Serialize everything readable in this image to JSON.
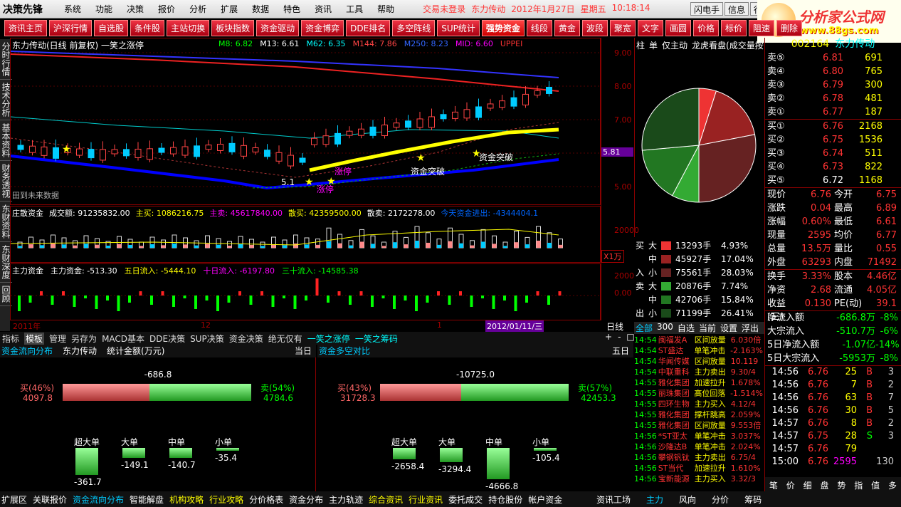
{
  "app": {
    "logo": "决策先锋",
    "menus": [
      "系统",
      "功能",
      "决策",
      "报价",
      "分析",
      "扩展",
      "数据",
      "特色",
      "资讯",
      "工具",
      "帮助"
    ],
    "login": "交易未登录",
    "stock_head": "东力传动",
    "date": "2012年1月27日",
    "weekday": "星期五",
    "time": "10:18:14",
    "right_buttons": [
      "闪电手",
      "信息",
      "行"
    ]
  },
  "brand": {
    "name": "分析家公式网",
    "url": "www.88gs.com"
  },
  "toolbar": [
    "资讯主页",
    "沪深行情",
    "自选股",
    "条件股",
    "主站切换",
    "板块指数",
    "资金驱动",
    "资金博弈",
    "DDE排名",
    "多空阵线",
    "SUP统计",
    "强势资金",
    "线段",
    "黄金",
    "波段",
    "聚宽",
    "文字",
    "画圆",
    "价格",
    "标价",
    "阻速",
    "删除"
  ],
  "side": [
    "分时行情",
    "技术分析",
    "基本资料",
    "财务透视",
    "东财资料",
    "东财深度",
    "回顾"
  ],
  "main": {
    "title": "东力传动(日线 前复权) 一笑之涨停",
    "ma": [
      {
        "t": "M8: 6.82",
        "c": "#0f0"
      },
      {
        "t": "M13: 6.61",
        "c": "#fff"
      },
      {
        "t": "M62: 6.35",
        "c": "#0ff"
      },
      {
        "t": "M144: 7.86",
        "c": "#f44"
      },
      {
        "t": "M250: 8.23",
        "c": "#36f"
      },
      {
        "t": "MID: 6.60",
        "c": "#f0f"
      },
      {
        "t": "UPPEI",
        "c": "#f33"
      }
    ],
    "yaxis": [
      "9.00",
      "8.00",
      "7.00",
      "5.81",
      "5.00"
    ],
    "ann": [
      "资金突破",
      "资金突破",
      "涨停",
      "涨停",
      "5.1"
    ],
    "nofuture": "田到未来数据"
  },
  "sub1": {
    "label": "庄散资金",
    "items": [
      "成交额: 91235832.00",
      "主买: 1086216.75",
      "主卖: 45617840.00",
      "散买: 42359500.00",
      "散卖: 2172278.00",
      "今天资金进出: -4344404.1"
    ],
    "yaxis": [
      "20000",
      "X1万"
    ]
  },
  "sub2": {
    "label": "主力资金",
    "items": [
      "主力资金: -513.30",
      "五日流入: -5444.10",
      "十日流入: -6197.80",
      "三十流入: -14585.38"
    ],
    "yaxis": [
      "2000",
      "0.00"
    ]
  },
  "timeaxis": {
    "t1": "2011年",
    "t2": "12",
    "t3": "1",
    "t4": "2012/01/11/三",
    "t5": "日线"
  },
  "tabs1": [
    "指标",
    "模板",
    "管理",
    "另存为",
    "MACD基本",
    "DDE决策",
    "SUP决策",
    "资金决策",
    "绝无仅有",
    "一笑之涨停",
    "一笑之筹码"
  ],
  "panelL": {
    "title": "资金流向分布",
    "stock": "东力传动",
    "unit": "统计金额(万元)",
    "period": "当日",
    "diff": "-686.8",
    "buy_pct": "买(46%)",
    "buy_val": "4097.8",
    "sell_pct": "卖(54%)",
    "sell_val": "4784.6",
    "cats": [
      {
        "n": "超大单",
        "v": "-361.7"
      },
      {
        "n": "大单",
        "v": "-149.1"
      },
      {
        "n": "中单",
        "v": "-140.7"
      },
      {
        "n": "小单",
        "v": "-35.4"
      }
    ]
  },
  "panelR": {
    "title": "资金多空对比",
    "period": "五日",
    "diff": "-10725.0",
    "buy_pct": "买(43%)",
    "buy_val": "31728.3",
    "sell_pct": "卖(57%)",
    "sell_val": "42453.3",
    "cats": [
      {
        "n": "超大单",
        "v": "-2658.4"
      },
      {
        "n": "大单",
        "v": "-3294.4"
      },
      {
        "n": "中单",
        "v": "-4666.8"
      },
      {
        "n": "小单",
        "v": "-105.4"
      }
    ]
  },
  "pie": {
    "tabs": [
      "柱",
      "单",
      "仅主动",
      "龙虎看盘(成交量按"
    ],
    "slices": [
      {
        "v": 4.93,
        "c": "#e33"
      },
      {
        "v": 17.04,
        "c": "#922"
      },
      {
        "v": 28.03,
        "c": "#622"
      },
      {
        "v": 7.74,
        "c": "#3a3"
      },
      {
        "v": 15.84,
        "c": "#272"
      },
      {
        "v": 26.41,
        "c": "#1a4a1a"
      }
    ]
  },
  "bigs": [
    {
      "g": "买",
      "k": "大",
      "v": "13293手",
      "p": "4.93%",
      "c": "#e33"
    },
    {
      "g": "",
      "k": "中",
      "v": "45927手",
      "p": "17.04%",
      "c": "#922"
    },
    {
      "g": "入",
      "k": "小",
      "v": "75561手",
      "p": "28.03%",
      "c": "#622"
    },
    {
      "g": "卖",
      "k": "大",
      "v": "20876手",
      "p": "7.74%",
      "c": "#3a3"
    },
    {
      "g": "",
      "k": "中",
      "v": "42706手",
      "p": "15.84%",
      "c": "#272"
    },
    {
      "g": "出",
      "k": "小",
      "v": "71199手",
      "p": "26.41%",
      "c": "#1a4a1a"
    }
  ],
  "dealtabs": [
    "全部",
    "300",
    "自选",
    "当前",
    "设置",
    "浮出"
  ],
  "deals": [
    [
      "14:54",
      "闽福发A",
      "区间放量",
      "6.030倍"
    ],
    [
      "14:54",
      "ST盛达",
      "单笔冲击",
      "-2.163%"
    ],
    [
      "14:54",
      "华闻传媒",
      "区间放量",
      "10.119"
    ],
    [
      "14:54",
      "中联重科",
      "主力卖出",
      "9.30/4"
    ],
    [
      "14:55",
      "雅化集团",
      "加速拉升",
      "1.678%"
    ],
    [
      "14:55",
      "丽珠集团",
      "高位回落",
      "-1.514%"
    ],
    [
      "14:55",
      "四环生物",
      "主力买入",
      "4.12/4"
    ],
    [
      "14:55",
      "雅化集团",
      "撑杆跳高",
      "2.059%"
    ],
    [
      "14:55",
      "雅化集团",
      "区间放量",
      "9.553倍"
    ],
    [
      "14:56",
      "*ST亚太",
      "单笔冲击",
      "3.037%"
    ],
    [
      "14:56",
      "沙隆达B",
      "单笔冲击",
      "2.024%"
    ],
    [
      "14:56",
      "攀钢钒钛",
      "主力卖出",
      "6.75/4"
    ],
    [
      "14:56",
      "ST当代",
      "加速拉升",
      "1.610%"
    ],
    [
      "14:56",
      "宝新能源",
      "主力买入",
      "3.32/3"
    ]
  ],
  "quote": {
    "code": "002164",
    "name": "东力传动",
    "sells": [
      {
        "l": "卖⑤",
        "p": "6.81",
        "v": "691"
      },
      {
        "l": "卖④",
        "p": "6.80",
        "v": "765"
      },
      {
        "l": "卖③",
        "p": "6.79",
        "v": "300"
      },
      {
        "l": "卖②",
        "p": "6.78",
        "v": "481"
      },
      {
        "l": "卖①",
        "p": "6.77",
        "v": "187"
      }
    ],
    "buys": [
      {
        "l": "买①",
        "p": "6.76",
        "v": "2168"
      },
      {
        "l": "买②",
        "p": "6.75",
        "v": "1536"
      },
      {
        "l": "买③",
        "p": "6.74",
        "v": "511"
      },
      {
        "l": "买④",
        "p": "6.73",
        "v": "822"
      },
      {
        "l": "买⑤",
        "p": "6.72",
        "v": "1168"
      }
    ],
    "stats": [
      [
        "现价",
        "6.76",
        "今开",
        "6.75"
      ],
      [
        "涨跌",
        "0.04",
        "最高",
        "6.89"
      ],
      [
        "涨幅",
        "0.60%",
        "最低",
        "6.61"
      ],
      [
        "现量",
        "2595",
        "均价",
        "6.77"
      ],
      [
        "总量",
        "13.5万",
        "量比",
        "0.55"
      ],
      [
        "外盘",
        "63293",
        "内盘",
        "71492"
      ]
    ],
    "stats2": [
      [
        "换手",
        "3.33%",
        "股本",
        "4.46亿"
      ],
      [
        "净资",
        "2.68",
        "流通",
        "4.05亿"
      ],
      [
        "收益(三)",
        "0.130",
        "PE(动)",
        "39.1"
      ]
    ],
    "flow": [
      [
        "净流入额",
        "-686.8万",
        "-8%"
      ],
      [
        "大宗流入",
        "-510.7万",
        "-6%"
      ],
      [
        "5日净流入额",
        "-1.07亿",
        "-14%"
      ],
      [
        "5日大宗流入",
        "-5953万",
        "-8%"
      ]
    ],
    "ticks": [
      [
        "14:56",
        "6.76",
        "25",
        "B",
        "3"
      ],
      [
        "14:56",
        "6.76",
        "7",
        "B",
        "2"
      ],
      [
        "14:56",
        "6.76",
        "63",
        "B",
        "7"
      ],
      [
        "14:56",
        "6.76",
        "30",
        "B",
        "5"
      ],
      [
        "14:57",
        "6.76",
        "8",
        "B",
        "2"
      ],
      [
        "14:57",
        "6.75",
        "28",
        "S",
        "3"
      ],
      [
        "14:57",
        "6.76",
        "79",
        "",
        ""
      ],
      [
        "15:00",
        "6.76",
        "2595",
        "",
        "130"
      ]
    ],
    "bottomtabs": [
      "笔",
      "价",
      "细",
      "盘",
      "势",
      "指",
      "值",
      "多"
    ]
  },
  "status": [
    "扩展区",
    "关联报价",
    "资金流向分布",
    "智能解盘",
    "机构攻略",
    "行业攻略",
    "分价格表",
    "资金分布",
    "主力轨迹",
    "综合资讯",
    "行业资讯",
    "委托成交",
    "持仓股份",
    "帐户资金"
  ],
  "statusR": [
    "资讯工场",
    "主力",
    "风向",
    "分价",
    "筹码"
  ]
}
